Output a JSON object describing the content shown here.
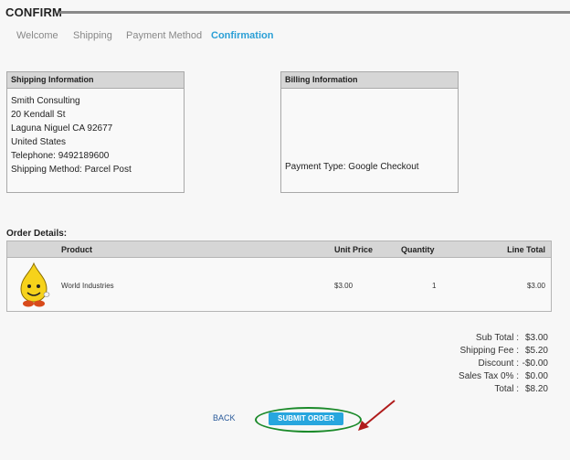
{
  "header": {
    "title": "CONFIRM"
  },
  "steps": [
    "Welcome",
    "Shipping",
    "Payment Method",
    "Confirmation"
  ],
  "shipping": {
    "heading": "Shipping Information",
    "lines": [
      "Smith Consulting",
      "20 Kendall St",
      "Laguna Niguel  CA  92677",
      "United States",
      "Telephone:  9492189600",
      "Shipping Method: Parcel Post"
    ]
  },
  "billing": {
    "heading": "Billing Information",
    "payment": "Payment Type:  Google Checkout"
  },
  "order": {
    "label": "Order Details:",
    "columns": {
      "product": "Product",
      "unit_price": "Unit Price",
      "quantity": "Quantity",
      "line_total": "Line Total"
    },
    "items": [
      {
        "product": "World Industries",
        "unit_price": "$3.00",
        "quantity": "1",
        "line_total": "$3.00"
      }
    ]
  },
  "totals": [
    {
      "label": "Sub Total :",
      "value": "$3.00"
    },
    {
      "label": "Shipping Fee :",
      "value": "$5.20"
    },
    {
      "label": "Discount :",
      "value": "-$0.00"
    },
    {
      "label": "Sales Tax 0% :",
      "value": "$0.00"
    },
    {
      "label": "Total :",
      "value": "$8.20"
    }
  ],
  "actions": {
    "back": "BACK",
    "submit": "SUBMIT ORDER"
  },
  "colors": {
    "accent": "#2a9fd6",
    "button": "#28a6de",
    "highlight_ring": "#1b8a2a",
    "arrow": "#b01c1c"
  }
}
